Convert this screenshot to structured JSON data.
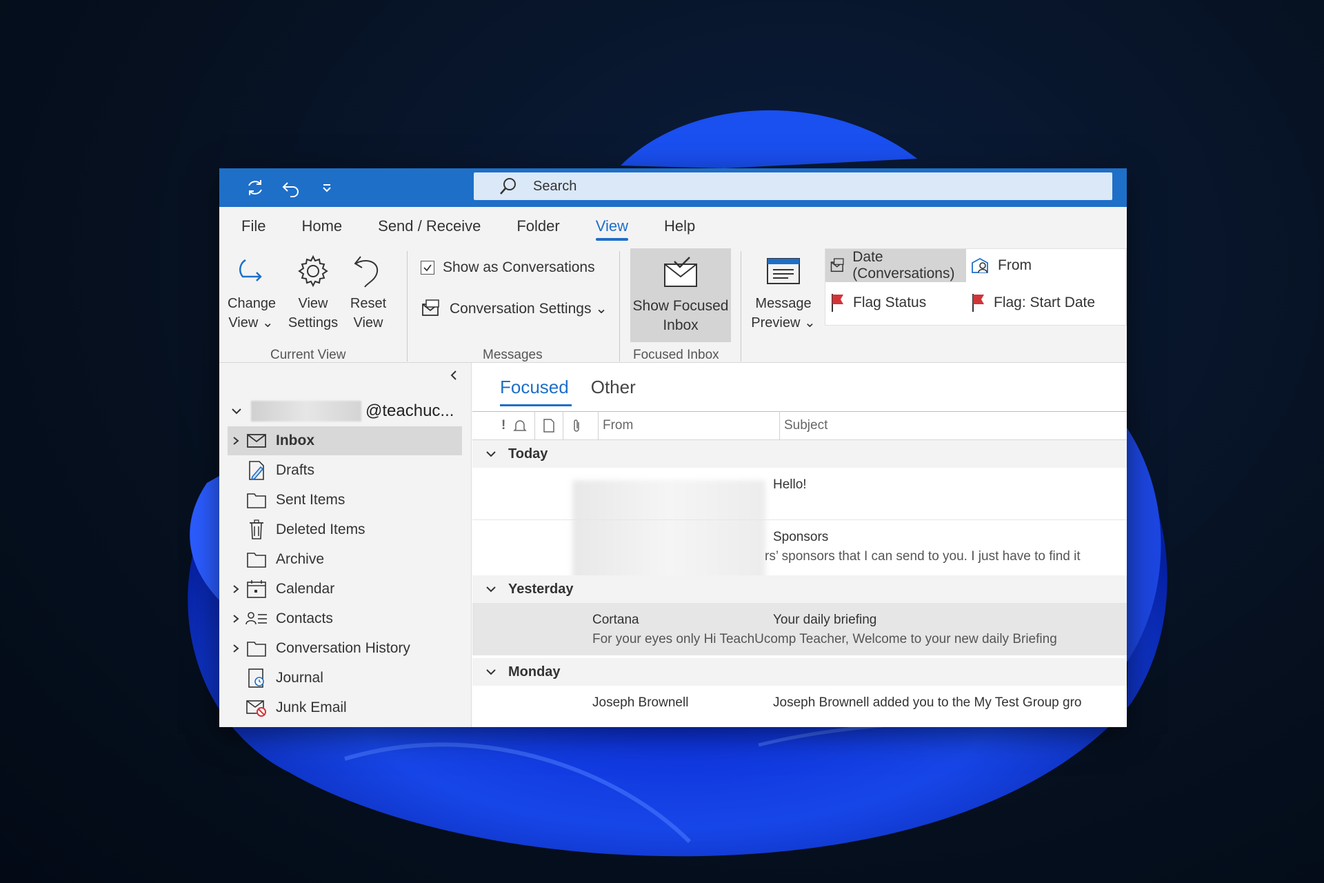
{
  "quick_access": {
    "sync_icon": "sync-icon",
    "undo_icon": "undo-icon",
    "customize_icon": "customize-qat-icon"
  },
  "search": {
    "placeholder": "Search"
  },
  "menu": [
    "File",
    "Home",
    "Send / Receive",
    "Folder",
    "View",
    "Help"
  ],
  "menu_active": "View",
  "ribbon": {
    "current_view": {
      "change_view": [
        "Change",
        "View"
      ],
      "view_settings": [
        "View",
        "Settings"
      ],
      "reset_view": [
        "Reset",
        "View"
      ],
      "label": "Current View"
    },
    "messages": {
      "show_conversations": "Show as Conversations",
      "conversation_settings": "Conversation Settings",
      "label": "Messages"
    },
    "focused_inbox": {
      "button": [
        "Show Focused",
        "Inbox"
      ],
      "label": "Focused Inbox"
    },
    "message_preview": [
      "Message",
      "Preview"
    ],
    "arrangement": {
      "date": "Date (Conversations)",
      "from": "From",
      "flag_status": "Flag Status",
      "flag_start": "Flag: Start Date"
    }
  },
  "nav": {
    "account": "@teachuc...",
    "folders": [
      {
        "label": "Inbox",
        "icon": "envelope-icon",
        "expandable": true,
        "selected": true
      },
      {
        "label": "Drafts",
        "icon": "draft-icon",
        "expandable": false
      },
      {
        "label": "Sent Items",
        "icon": "folder-icon",
        "expandable": false
      },
      {
        "label": "Deleted Items",
        "icon": "trash-icon",
        "expandable": false
      },
      {
        "label": "Archive",
        "icon": "folder-icon",
        "expandable": false
      },
      {
        "label": "Calendar",
        "icon": "calendar-icon",
        "expandable": true
      },
      {
        "label": "Contacts",
        "icon": "contacts-icon",
        "expandable": true
      },
      {
        "label": "Conversation History",
        "icon": "folder-icon",
        "expandable": true
      },
      {
        "label": "Journal",
        "icon": "journal-icon",
        "expandable": false
      },
      {
        "label": "Junk Email",
        "icon": "junk-icon",
        "expandable": false
      }
    ]
  },
  "mail": {
    "tabs": [
      "Focused",
      "Other"
    ],
    "columns": {
      "flag": "!",
      "from": "From",
      "subject": "Subject"
    },
    "groups": {
      "today": "Today",
      "yesterday": "Yesterday",
      "monday": "Monday"
    },
    "messages": {
      "m1": {
        "subject": "Hello!"
      },
      "m2": {
        "subject": "Sponsors",
        "preview": "rs’ sponsors that I can send to you. I just have to find it"
      },
      "m3": {
        "from": "Cortana",
        "subject": "Your daily briefing",
        "preview": "For your eyes only  Hi TeachUcomp Teacher,   Welcome to your new daily Briefing"
      },
      "m4": {
        "from": "Joseph Brownell",
        "subject": "Joseph Brownell added you to the My Test Group gro"
      }
    }
  },
  "colors": {
    "accent": "#1e6fc8",
    "flag_red": "#d13438"
  }
}
